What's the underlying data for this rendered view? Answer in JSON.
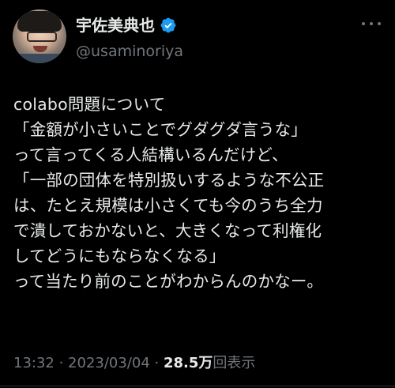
{
  "user": {
    "display_name": "宇佐美典也",
    "handle": "@usaminoriya",
    "verified_icon": "verified-badge-icon",
    "verified_color": "#1d9bf0"
  },
  "tweet": {
    "lines": [
      "colabo問題について",
      "「金額が小さいことでグダグダ言うな」",
      "って言ってくる人結構いるんだけど、",
      "「一部の団体を特別扱いするような不公正",
      "は、たとえ規模は小さくても今のうち全力",
      "で潰しておかないと、大きくなって利権化",
      "してどうにもならなくなる」",
      "って当たり前のことがわからんのかなー。"
    ]
  },
  "meta": {
    "time": "13:32",
    "separator1": " · ",
    "date": "2023/03/04",
    "separator2": " · ",
    "views_count": "28.5万",
    "views_label": "回表示"
  },
  "more_icon": "more-options-icon"
}
